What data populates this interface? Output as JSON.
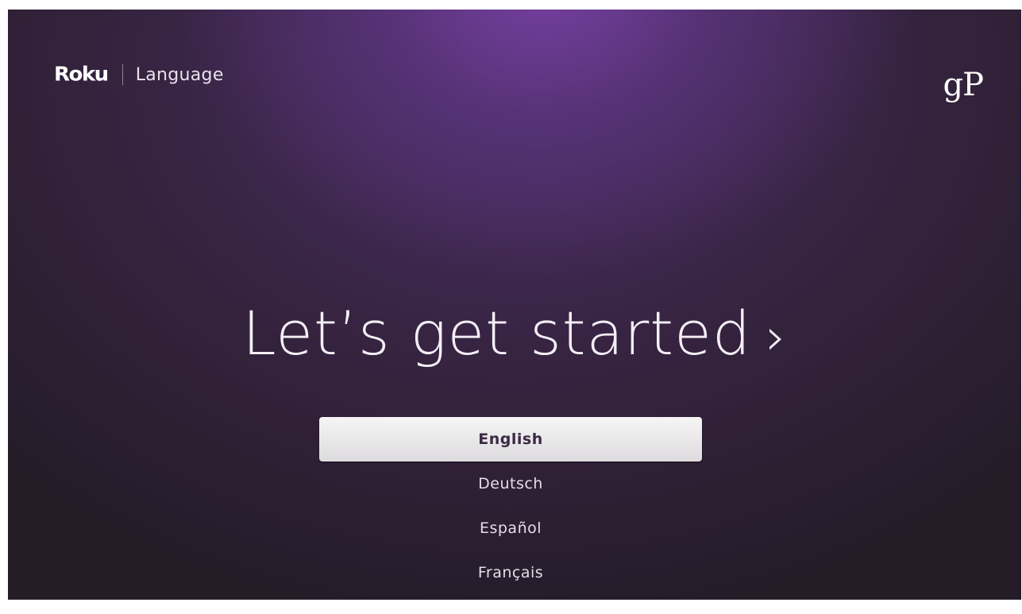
{
  "header": {
    "brand": "Roku",
    "title": "Language"
  },
  "watermark": "gP",
  "hero": {
    "text": "Let’s get started",
    "chevron": "›"
  },
  "languages": [
    {
      "label": "English",
      "selected": true
    },
    {
      "label": "Deutsch",
      "selected": false
    },
    {
      "label": "Español",
      "selected": false
    },
    {
      "label": "Français",
      "selected": false
    }
  ],
  "colors": {
    "accent_purple": "#7a42a8",
    "background_dark": "#251c28",
    "selected_bg": "#eeeeee",
    "selected_text": "#3b2a48"
  }
}
